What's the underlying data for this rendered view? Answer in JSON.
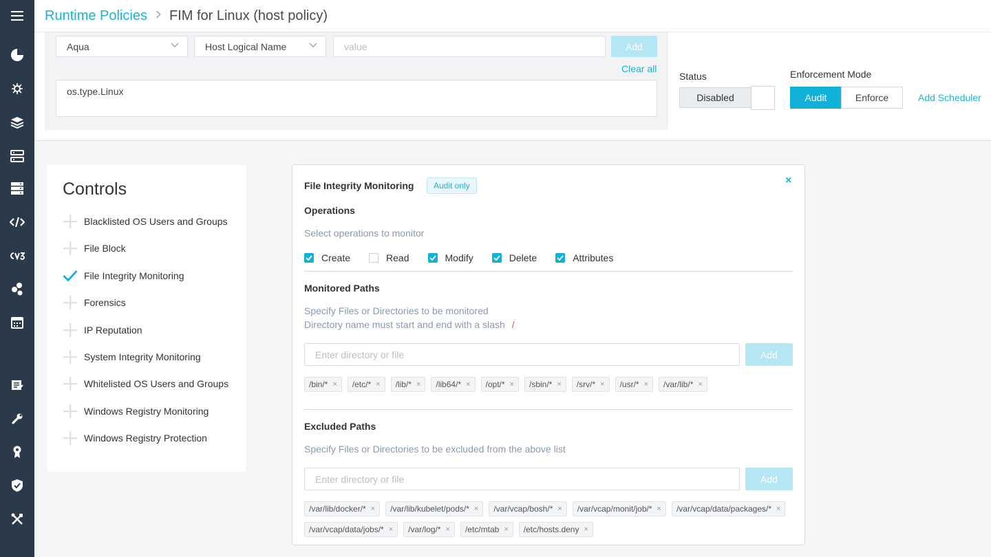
{
  "header": {
    "breadcrumb_root": "Runtime Policies",
    "breadcrumb_current": "FIM for Linux (host policy)"
  },
  "scope": {
    "source_select": "Aqua",
    "attribute_select": "Host Logical Name",
    "value_placeholder": "value",
    "add_label": "Add",
    "clear_all_label": "Clear all",
    "expression": "os.type.Linux"
  },
  "status": {
    "label": "Status",
    "value": "Disabled"
  },
  "enforcement": {
    "label": "Enforcement Mode",
    "options": [
      "Audit",
      "Enforce"
    ],
    "selected": "Audit",
    "scheduler_label": "Add Scheduler"
  },
  "controls": {
    "title": "Controls",
    "items": [
      {
        "label": "Blacklisted OS Users and Groups",
        "active": false
      },
      {
        "label": "File Block",
        "active": false
      },
      {
        "label": "File Integrity Monitoring",
        "active": true
      },
      {
        "label": "Forensics",
        "active": false
      },
      {
        "label": "IP Reputation",
        "active": false
      },
      {
        "label": "System Integrity Monitoring",
        "active": false
      },
      {
        "label": "Whitelisted OS Users and Groups",
        "active": false
      },
      {
        "label": "Windows Registry Monitoring",
        "active": false
      },
      {
        "label": "Windows Registry Protection",
        "active": false
      }
    ]
  },
  "fim": {
    "title": "File Integrity Monitoring",
    "badge": "Audit only",
    "operations_title": "Operations",
    "operations_hint": "Select operations to monitor",
    "operations": [
      {
        "label": "Create",
        "checked": true
      },
      {
        "label": "Read",
        "checked": false
      },
      {
        "label": "Modify",
        "checked": true
      },
      {
        "label": "Delete",
        "checked": true
      },
      {
        "label": "Attributes",
        "checked": true
      }
    ],
    "monitored_title": "Monitored Paths",
    "monitored_hint_1": "Specify Files or Directories to be monitored",
    "monitored_hint_2": "Directory name must start and end with a slash",
    "monitored_hint_slash": "/",
    "monitored_placeholder": "Enter directory or file",
    "monitored_add": "Add",
    "monitored_paths": [
      "/bin/*",
      "/etc/*",
      "/lib/*",
      "/lib64/*",
      "/opt/*",
      "/sbin/*",
      "/srv/*",
      "/usr/*",
      "/var/lib/*"
    ],
    "excluded_title": "Excluded Paths",
    "excluded_hint": "Specify Files or Directories to be excluded from the above list",
    "excluded_placeholder": "Enter directory or file",
    "excluded_add": "Add",
    "excluded_paths": [
      "/var/lib/docker/*",
      "/var/lib/kubelet/pods/*",
      "/var/vcap/bosh/*",
      "/var/vcap/monit/job/*",
      "/var/vcap/data/packages/*",
      "/var/vcap/data/jobs/*",
      "/var/log/*",
      "/etc/mtab",
      "/etc/hosts.deny"
    ],
    "close_glyph": "×",
    "tag_remove_glyph": "×"
  },
  "sidebar_icons": [
    "menu-icon",
    "dashboard-icon",
    "bug-icon",
    "layers-icon",
    "network-icon",
    "server-icon",
    "code-icon",
    "cve-icon",
    "nodes-icon",
    "calendar-icon",
    "report-icon",
    "wrench-icon",
    "award-icon",
    "shield-icon",
    "tools-icon"
  ],
  "colors": {
    "accent": "#12b1d9",
    "sidebar": "#2b3a4a",
    "disabled_button": "#b4e6f3"
  }
}
